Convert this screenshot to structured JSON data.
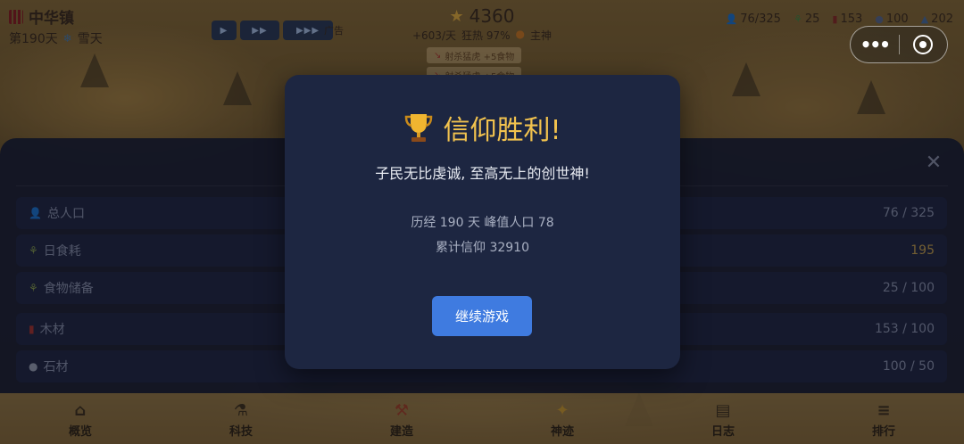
{
  "hud": {
    "town_name": "中华镇",
    "day": "第190天",
    "weather": "雪天",
    "speed_1": "▶",
    "speed_2": "▶▶",
    "speed_3": "▶▶▶",
    "ad_label": "广告",
    "faith_total": "4360",
    "faith_rate": "+603/天",
    "zeal": "狂热 97%",
    "zeal_icon_label": "主神",
    "resources": [
      {
        "icon": "person-icon",
        "value": "76/325"
      },
      {
        "icon": "wheat-icon",
        "value": "25"
      },
      {
        "icon": "wood-icon",
        "value": "153"
      },
      {
        "icon": "stone-icon",
        "value": "100"
      },
      {
        "icon": "faith-icon",
        "value": "202"
      }
    ]
  },
  "messages": [
    "射杀猛虎 +5食物",
    "射杀猛虎 +5食物"
  ],
  "capsule": {
    "more": "•••",
    "close": "◎"
  },
  "panel": {
    "rows": [
      {
        "label": "总人口",
        "value": "76 / 325",
        "icon": "person-icon"
      },
      {
        "label": "日食耗",
        "value": "195",
        "icon": "wheat-icon"
      },
      {
        "label": "食物储备",
        "value": "25 / 100",
        "icon": "wheat-icon"
      },
      {
        "label": "木材",
        "value": "153 / 100",
        "icon": "wood-icon"
      },
      {
        "label": "石材",
        "value": "100 / 50",
        "icon": "stone-icon"
      }
    ],
    "close": "✕"
  },
  "modal": {
    "title": "信仰胜利!",
    "subtitle": "子民无比虔诚, 至高无上的创世神!",
    "stats_line1": "历经 190 天  峰值人口 78",
    "stats_line2": "累计信仰 32910",
    "button": "继续游戏"
  },
  "nav": [
    {
      "label": "概览",
      "icon": "home-icon"
    },
    {
      "label": "科技",
      "icon": "telescope-icon"
    },
    {
      "label": "建造",
      "icon": "crane-icon"
    },
    {
      "label": "神迹",
      "icon": "star-icon"
    },
    {
      "label": "日志",
      "icon": "scroll-icon"
    },
    {
      "label": "排行",
      "icon": "ranking-icon"
    }
  ],
  "colors": {
    "modal_bg": "#1d2641",
    "title_gold": "#f1c24e",
    "button_blue": "#3f7be0",
    "panel_bg": "#181e30"
  }
}
